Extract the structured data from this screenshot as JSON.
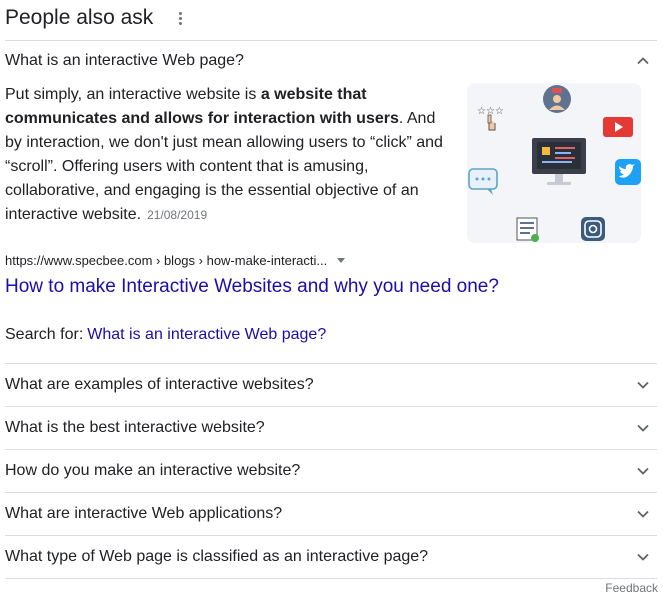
{
  "header": {
    "title": "People also ask"
  },
  "expanded": {
    "question": "What is an interactive Web page?",
    "answer_pre": "Put simply, an interactive website is ",
    "answer_bold": "a website that communicates and allows for interaction with users",
    "answer_post": ". And by interaction, we don't just mean allowing users to “click” and “scroll”. Offering users with content that is amusing, collaborative, and engaging is the essential objective of an interactive website.",
    "date": "21/08/2019",
    "source_url": "https://www.specbee.com › blogs › how-make-interacti...",
    "result_title": "How to make Interactive Websites and why you need one?",
    "search_for_label": "Search for:",
    "search_for_query": "What is an interactive Web page?",
    "image_stars": "☆☆☆"
  },
  "questions": [
    "What are examples of interactive websites?",
    "What is the best interactive website?",
    "How do you make an interactive website?",
    "What are interactive Web applications?",
    "What type of Web page is classified as an interactive page?"
  ],
  "feedback_label": "Feedback",
  "colors": {
    "text": "#202124",
    "link": "#1a0dab",
    "muted": "#70757a",
    "divider": "#dadce0"
  }
}
